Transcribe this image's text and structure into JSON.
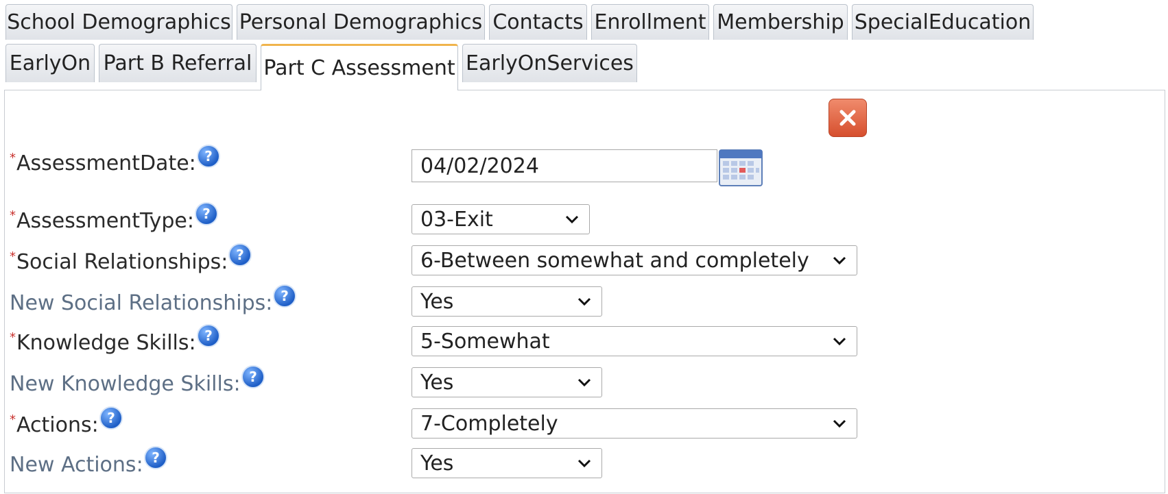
{
  "tabs_row1": [
    "School Demographics",
    "Personal Demographics",
    "Contacts",
    "Enrollment",
    "Membership",
    "SpecialEducation"
  ],
  "tabs_row2": [
    "EarlyOn",
    "Part B Referral",
    "Part C Assessment",
    "EarlyOnServices"
  ],
  "active_tab": "Part C Assessment",
  "close_button_color": "#e0583a",
  "form": {
    "fields": [
      {
        "label": "AssessmentDate",
        "required": true,
        "type": "date",
        "value": "04/02/2024"
      },
      {
        "label": "AssessmentType",
        "required": true,
        "type": "select",
        "value": "03-Exit"
      },
      {
        "label": "Social Relationships",
        "required": true,
        "type": "select",
        "value": "6-Between somewhat and completely"
      },
      {
        "label": "New Social Relationships",
        "required": false,
        "type": "select",
        "value": "Yes"
      },
      {
        "label": "Knowledge Skills",
        "required": true,
        "type": "select",
        "value": "5-Somewhat"
      },
      {
        "label": "New Knowledge Skills",
        "required": false,
        "type": "select",
        "value": "Yes"
      },
      {
        "label": "Actions",
        "required": true,
        "type": "select",
        "value": "7-Completely"
      },
      {
        "label": "New Actions",
        "required": false,
        "type": "select",
        "value": "Yes"
      }
    ]
  },
  "icons": {
    "help": "help-icon",
    "calendar": "calendar-icon",
    "close": "close-icon",
    "dropdown": "chevron-down-icon"
  },
  "required_marker": "*",
  "label_suffix": ":"
}
